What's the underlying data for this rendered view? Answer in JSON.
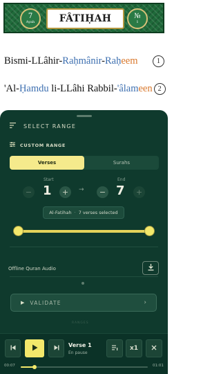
{
  "quran": {
    "surah_title": "FÂTIḤAH",
    "left_medallion": {
      "main": "7",
      "sub": "Ayah"
    },
    "right_medallion": {
      "main": "№",
      "sub": "1"
    },
    "verses": [
      {
        "parts": [
          "Bismi-LLâhir-",
          "Raḥmânir",
          "-",
          "Raḥ",
          "eem"
        ],
        "number": "1"
      },
      {
        "parts": [
          "'Al-",
          "Ḥamdu",
          " li-LLâhi Rabbil-",
          "'âlam",
          "een"
        ],
        "number": "2"
      }
    ]
  },
  "sheet": {
    "title": "SELECT RANGE",
    "custom_label": "CUSTOM RANGE",
    "toggle": {
      "verses": "Verses",
      "surahs": "Surahs",
      "selected": "Verses"
    },
    "start_label": "Start",
    "end_label": "End",
    "start_value": "1",
    "end_value": "7",
    "minus_symbol": "−",
    "plus_symbol": "+",
    "arrow_symbol": "→",
    "selection_surah": "Al-Fatihah",
    "selection_separator": "·",
    "selection_count": "7 verses selected",
    "range_slider": {
      "min": 1,
      "max": 7,
      "start": 1,
      "end": 7
    },
    "offline_label": "Offline Quran Audio",
    "validate_label": "VALIDATE",
    "footer_text": "RANGES"
  },
  "player": {
    "track_title": "Verse 1",
    "track_status": "En pause",
    "speed_label": "x1",
    "time_current": "00:07",
    "time_total": "01:01",
    "progress_fraction": 0.11
  },
  "colors": {
    "sheet_bg": "#0f3a2d",
    "accent_yellow": "#f3e86b",
    "banner_green": "#1f6a3a"
  },
  "icons": {
    "sheet_header": "sort-lines-icon",
    "custom_range": "sliders-icon",
    "download": "download-icon",
    "validate": "play-icon",
    "validate_chevron": "chevron-right-icon",
    "prev": "skip-previous-icon",
    "play": "play-icon",
    "next": "skip-next-icon",
    "playlist": "playlist-icon",
    "close": "close-icon"
  }
}
